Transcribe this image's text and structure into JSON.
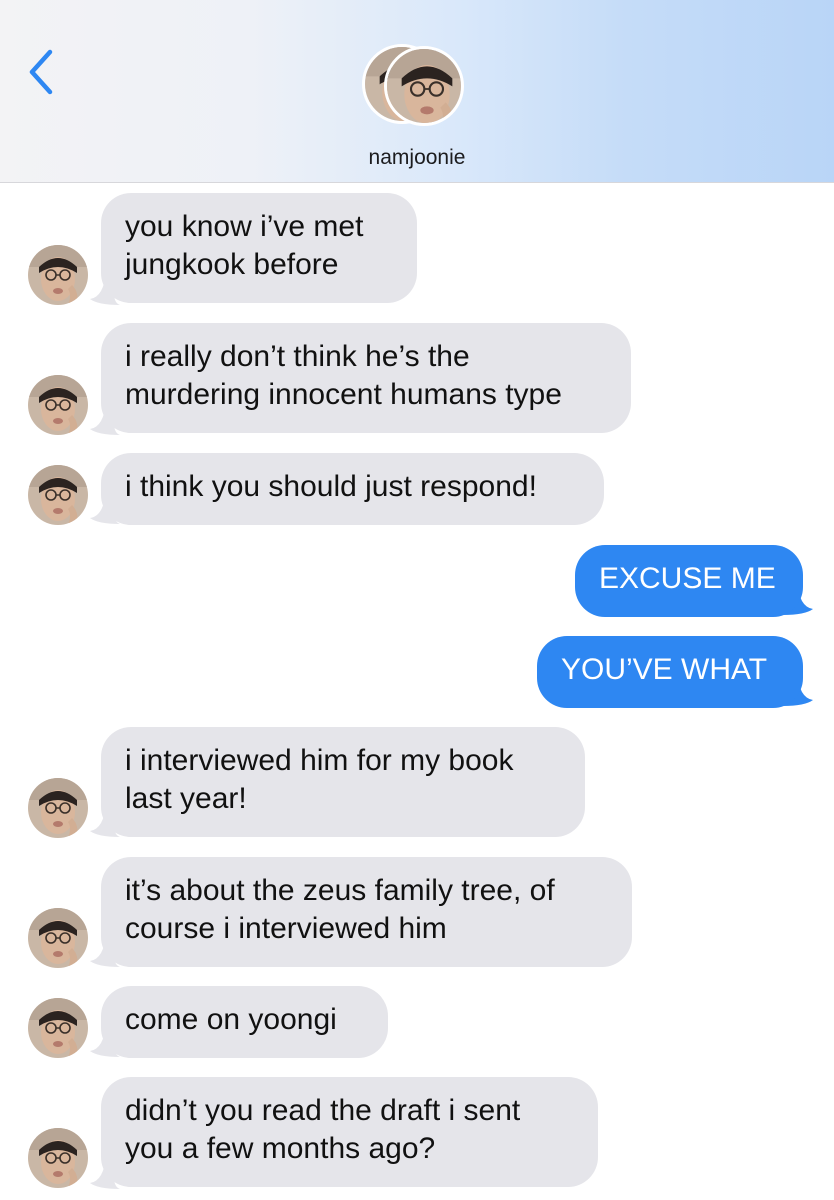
{
  "header": {
    "back_icon": "chevron-left-icon",
    "contact_name": "namjoonie"
  },
  "colors": {
    "incoming_bubble": "#e5e5ea",
    "outgoing_bubble": "#2e87f2",
    "back_chevron": "#2e87f2"
  },
  "messages": [
    {
      "direction": "incoming",
      "text": "you know i’ve met\njungkook before"
    },
    {
      "direction": "incoming",
      "text": "i really don’t think he’s the\nmurdering innocent humans type"
    },
    {
      "direction": "incoming",
      "text": "i think you should just respond!"
    },
    {
      "direction": "outgoing",
      "text": "EXCUSE ME"
    },
    {
      "direction": "outgoing",
      "text": "YOU’VE WHAT"
    },
    {
      "direction": "incoming",
      "text": "i interviewed him for my book\nlast year!"
    },
    {
      "direction": "incoming",
      "text": "it’s about the zeus family tree, of\ncourse i interviewed him"
    },
    {
      "direction": "incoming",
      "text": "come on yoongi"
    },
    {
      "direction": "incoming",
      "text": "didn’t you read the draft i sent\nyou a few months ago?"
    }
  ]
}
